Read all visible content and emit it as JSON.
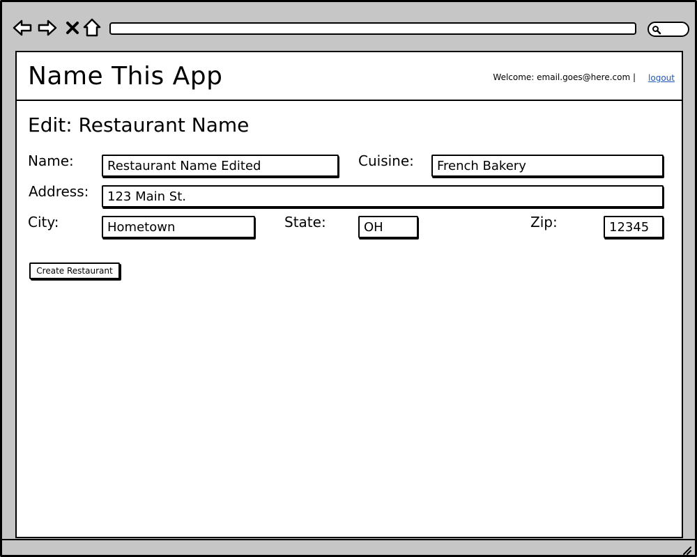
{
  "browser": {
    "back_icon": "arrow-left-icon",
    "forward_icon": "arrow-right-icon",
    "stop_icon": "close-icon",
    "home_icon": "home-icon",
    "url": "",
    "search_icon": "search-icon"
  },
  "header": {
    "app_title": "Name This App",
    "welcome": "Welcome: email.goes@here.com |",
    "logout": "logout"
  },
  "page": {
    "heading": "Edit: Restaurant Name"
  },
  "form": {
    "name_label": "Name:",
    "name_value": "Restaurant Name Edited",
    "cuisine_label": "Cuisine:",
    "cuisine_value": "French Bakery",
    "address_label": "Address:",
    "address_value": "123 Main St.",
    "city_label": "City:",
    "city_value": "Hometown",
    "state_label": "State:",
    "state_value": "OH",
    "zip_label": "Zip:",
    "zip_value": "12345",
    "submit_label": "Create Restaurant"
  }
}
